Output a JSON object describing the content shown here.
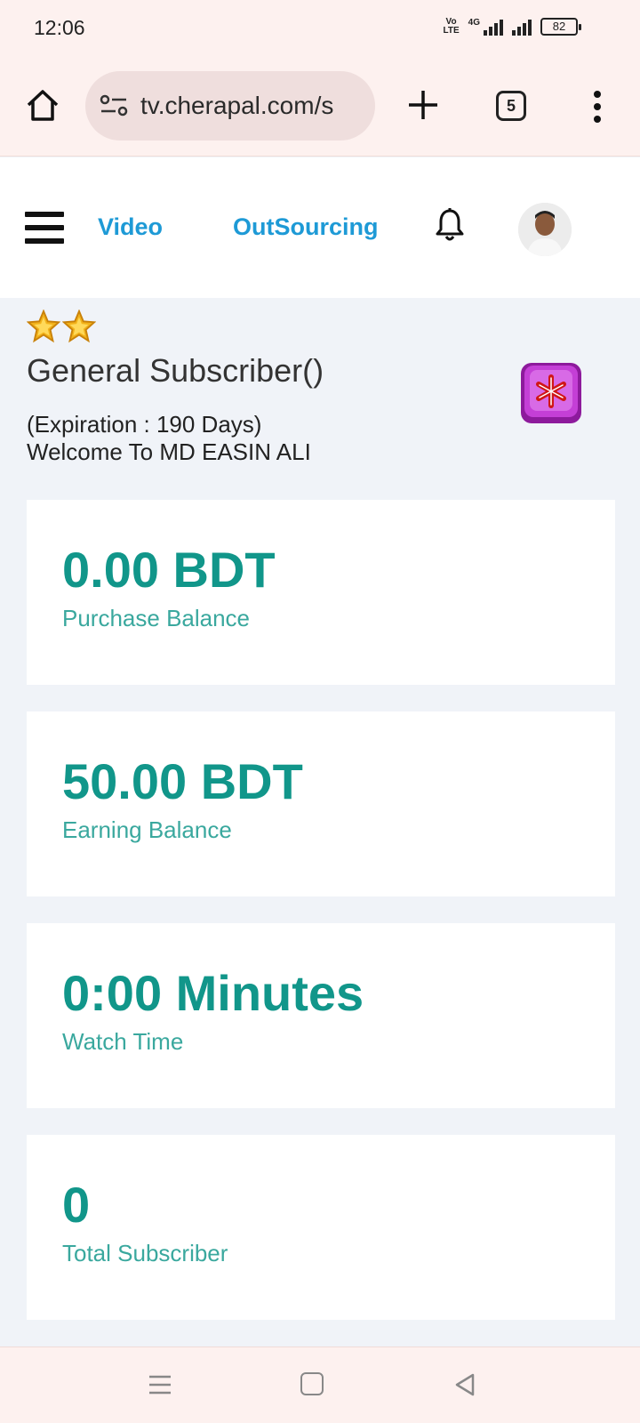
{
  "status_bar": {
    "time": "12:06",
    "volte": "Vo LTE",
    "network": "4G",
    "battery": "82"
  },
  "browser": {
    "url": "tv.cherapal.com/s",
    "tab_count": "5"
  },
  "header": {
    "nav": [
      {
        "label": "Video"
      },
      {
        "label": "OutSourcing"
      }
    ]
  },
  "profile": {
    "star_count": 2,
    "role": "General Subscriber()",
    "expiration": "(Expiration : 190 Days)",
    "welcome": "Welcome To MD EASIN ALI"
  },
  "cards": [
    {
      "value": "0.00 BDT",
      "label": "Purchase Balance"
    },
    {
      "value": "50.00 BDT",
      "label": "Earning Balance"
    },
    {
      "value": "0:00 Minutes",
      "label": "Watch Time"
    },
    {
      "value": "0",
      "label": "Total Subscriber"
    }
  ],
  "colors": {
    "accent_link": "#1e9ad6",
    "stat_value": "#11968a",
    "stat_label": "#3aa89e",
    "page_bg": "#f0f3f8",
    "chrome_bg": "#fdf1ef"
  },
  "icons": {
    "browser": [
      "home-icon",
      "site-settings-icon",
      "plus-icon",
      "tabs-icon",
      "more-vert-icon"
    ],
    "header": [
      "hamburger-icon",
      "bell-icon",
      "avatar"
    ],
    "profile": [
      "star-icon",
      "star-icon",
      "badge-icon"
    ],
    "system_nav": [
      "recents-icon",
      "home-square-icon",
      "back-icon"
    ]
  }
}
